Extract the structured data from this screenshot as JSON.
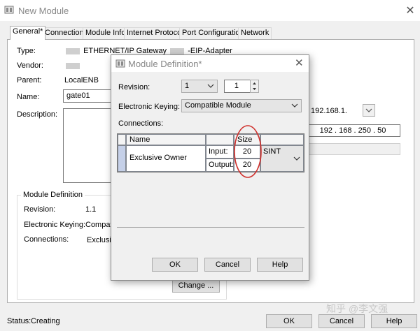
{
  "window": {
    "title": "New Module",
    "close": "✕"
  },
  "tabs": [
    "General*",
    "Connection",
    "Module Info",
    "Internet Protocol",
    "Port Configuration",
    "Network"
  ],
  "general": {
    "type_label": "Type:",
    "type_value_part1": "ETHERNET/IP Gateway",
    "type_value_part2": "-EIP-Adapter",
    "vendor_label": "Vendor:",
    "parent_label": "Parent:",
    "parent_value": "LocalENB",
    "name_label": "Name:",
    "name_value": "gate01",
    "description_label": "Description:",
    "ip_prefix": "192.168.1.",
    "ip_address": "192 . 168 . 250 . 50"
  },
  "module_definition": {
    "group_title": "Module Definition",
    "revision_label": "Revision:",
    "revision_value": "1.1",
    "keying_label": "Electronic Keying:",
    "keying_value": "Compatib",
    "connections_label": "Connections:",
    "connections_value": "Exclusiv",
    "change_button": "Change ..."
  },
  "status": {
    "label": "Status:",
    "value": "Creating"
  },
  "footer_buttons": {
    "ok": "OK",
    "cancel": "Cancel",
    "help": "Help"
  },
  "dialog": {
    "title": "Module Definition*",
    "close": "✕",
    "revision_label": "Revision:",
    "revision_major": "1",
    "revision_minor": "1",
    "keying_label": "Electronic Keying:",
    "keying_value": "Compatible Module",
    "connections_label": "Connections:",
    "columns": {
      "name": "Name",
      "size": "Size"
    },
    "row": {
      "name": "Exclusive Owner",
      "input_label": "Input:",
      "input_size": "20",
      "output_label": "Output:",
      "output_size": "20",
      "type": "SINT"
    },
    "buttons": {
      "ok": "OK",
      "cancel": "Cancel",
      "help": "Help"
    }
  },
  "watermark": "知乎 @李文强",
  "colors": {
    "annotation": "#d0312d",
    "accent_row": "#c5d0e8"
  }
}
